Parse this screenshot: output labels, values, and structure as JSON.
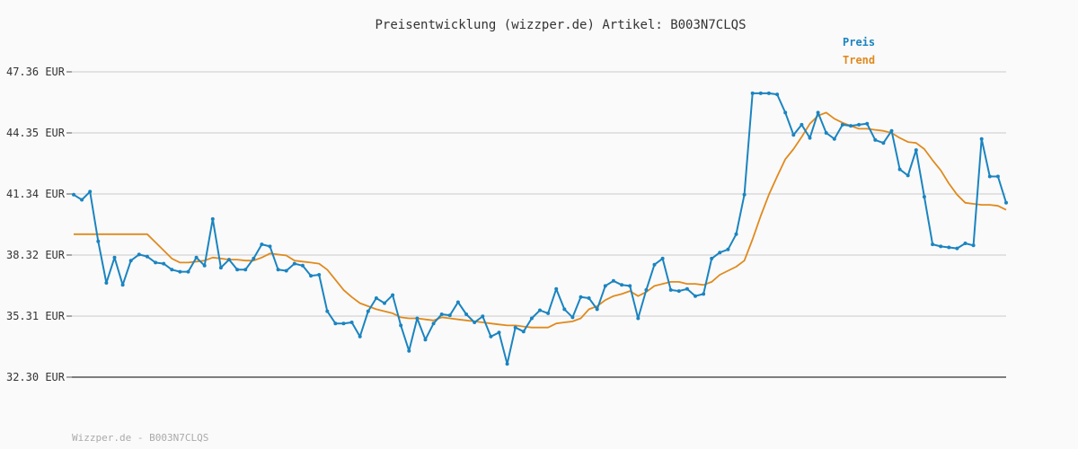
{
  "chart_data": {
    "type": "line",
    "title": "Preisentwicklung (wizzper.de) Artikel: B003N7CLQS",
    "footer": "Wizzper.de - B003N7CLQS",
    "y_ticks": [
      "47.36 EUR",
      "44.35 EUR",
      "41.34 EUR",
      "38.32 EUR",
      "35.31 EUR",
      "32.30 EUR"
    ],
    "ylim": [
      32.3,
      47.36
    ],
    "grid": true,
    "legend_position": "top-right",
    "colors": {
      "preis": "#1b84c0",
      "trend": "#e08a1e"
    },
    "series": [
      {
        "name": "Preis",
        "values": [
          41.3,
          41.05,
          41.45,
          39.0,
          36.95,
          38.2,
          36.85,
          38.05,
          38.35,
          38.25,
          37.95,
          37.9,
          37.6,
          37.5,
          37.5,
          38.2,
          37.8,
          40.1,
          37.7,
          38.1,
          37.6,
          37.6,
          38.15,
          38.85,
          38.75,
          37.6,
          37.55,
          37.9,
          37.8,
          37.3,
          37.35,
          35.55,
          34.95,
          34.95,
          35.0,
          34.3,
          35.55,
          36.2,
          35.95,
          36.35,
          34.85,
          33.6,
          35.2,
          34.15,
          34.95,
          35.4,
          35.35,
          36.0,
          35.4,
          35.0,
          35.3,
          34.3,
          34.5,
          32.95,
          34.75,
          34.55,
          35.2,
          35.6,
          35.45,
          36.65,
          35.65,
          35.25,
          36.25,
          36.2,
          35.65,
          36.8,
          37.05,
          36.85,
          36.8,
          35.2,
          36.6,
          37.85,
          38.15,
          36.6,
          36.55,
          36.65,
          36.3,
          36.4,
          38.15,
          38.45,
          38.6,
          39.35,
          41.3,
          46.3,
          46.3,
          46.3,
          46.25,
          45.35,
          44.25,
          44.75,
          44.1,
          45.35,
          44.35,
          44.05,
          44.75,
          44.7,
          44.75,
          44.8,
          44.0,
          43.85,
          44.45,
          42.55,
          42.25,
          43.5,
          41.2,
          38.85,
          38.75,
          38.7,
          38.65,
          38.9,
          38.8,
          44.05,
          42.2,
          42.2,
          40.9
        ]
      },
      {
        "name": "Trend",
        "values": [
          39.35,
          39.35,
          39.35,
          39.35,
          39.35,
          39.35,
          39.35,
          39.35,
          39.35,
          39.35,
          38.95,
          38.55,
          38.15,
          37.95,
          37.95,
          38.0,
          38.05,
          38.2,
          38.15,
          38.1,
          38.1,
          38.05,
          38.05,
          38.2,
          38.4,
          38.35,
          38.3,
          38.05,
          38.0,
          37.95,
          37.9,
          37.6,
          37.1,
          36.6,
          36.25,
          35.95,
          35.8,
          35.65,
          35.55,
          35.45,
          35.25,
          35.2,
          35.2,
          35.15,
          35.1,
          35.25,
          35.2,
          35.15,
          35.1,
          35.05,
          35.0,
          34.95,
          34.9,
          34.85,
          34.85,
          34.8,
          34.75,
          34.75,
          34.75,
          34.95,
          35.0,
          35.05,
          35.2,
          35.65,
          35.8,
          36.1,
          36.3,
          36.4,
          36.55,
          36.3,
          36.5,
          36.8,
          36.9,
          37.0,
          37.0,
          36.9,
          36.9,
          36.85,
          37.0,
          37.35,
          37.55,
          37.75,
          38.05,
          39.1,
          40.25,
          41.3,
          42.2,
          43.05,
          43.55,
          44.15,
          44.8,
          45.2,
          45.35,
          45.05,
          44.85,
          44.7,
          44.55,
          44.55,
          44.5,
          44.45,
          44.35,
          44.1,
          43.9,
          43.85,
          43.55,
          43.0,
          42.5,
          41.85,
          41.3,
          40.9,
          40.85,
          40.8,
          40.8,
          40.75,
          40.55
        ]
      }
    ]
  }
}
